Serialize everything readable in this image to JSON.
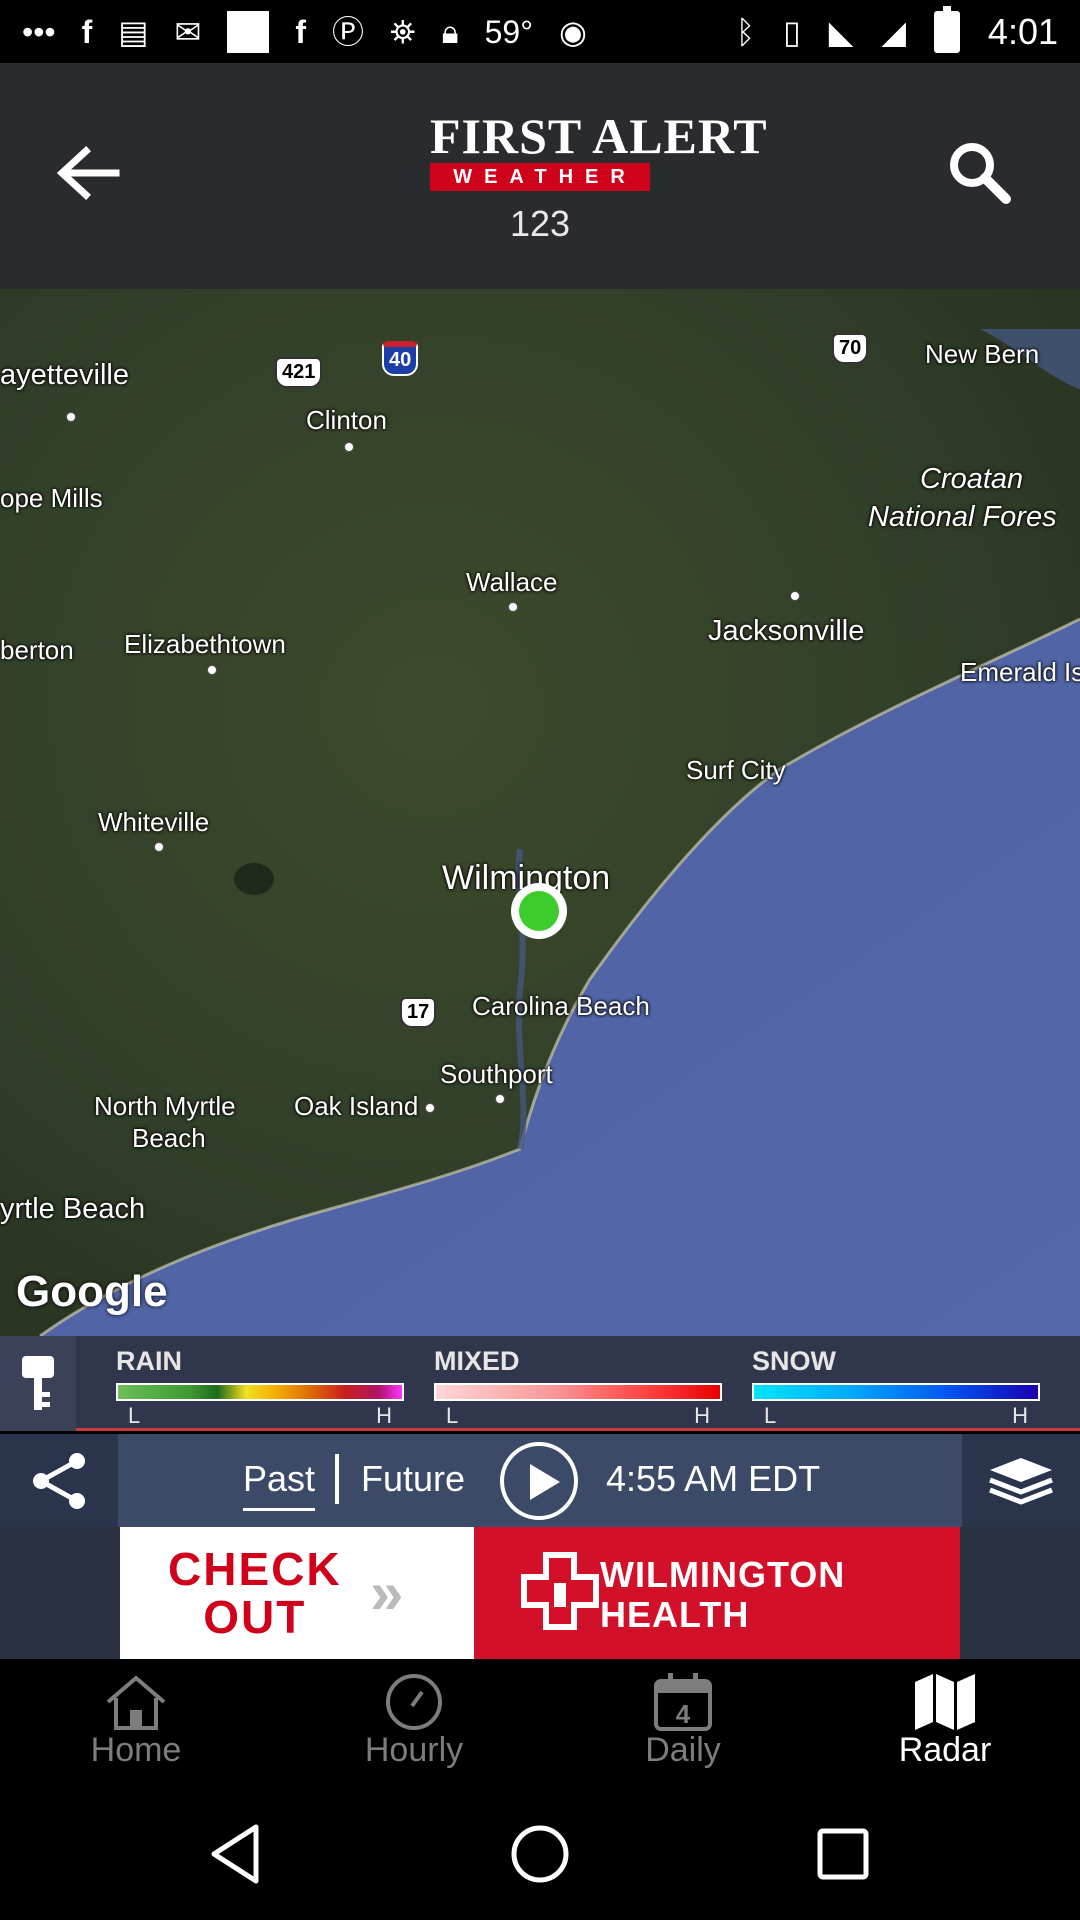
{
  "status_bar": {
    "temperature": "59°",
    "time": "4:01",
    "icons": [
      "more-icon",
      "facebook-icon",
      "news-icon",
      "mail-icon",
      "photo-icon",
      "facebook-icon",
      "p-icon",
      "satellite-icon",
      "lock-icon",
      "android-icon",
      "bluetooth-icon",
      "vibrate-icon",
      "wifi-icon",
      "signal-icon",
      "battery-icon"
    ]
  },
  "header": {
    "logo_main": "FIRST ALERT",
    "logo_sub": "WEATHER",
    "station": "123",
    "back_icon": "arrow-left-icon",
    "search_icon": "search-icon",
    "background": "#2a2b2e"
  },
  "map": {
    "cities": {
      "fayetteville": "ayetteville",
      "clinton": "Clinton",
      "new_bern": "New Bern",
      "hope_mills": "ope Mills",
      "croatan": "Croatan",
      "national_forest": "National Fores",
      "wallace": "Wallace",
      "jacksonville": "Jacksonville",
      "lumberton": "berton",
      "elizabethtown": "Elizabethtown",
      "emerald_isle": "Emerald Is",
      "surf_city": "Surf City",
      "whiteville": "Whiteville",
      "wilmington": "Wilmington",
      "carolina_beach": "Carolina Beach",
      "southport": "Southport",
      "north_myrtle_beach_1": "North Myrtle",
      "north_myrtle_beach_2": "Beach",
      "oak_island": "Oak Island",
      "myrtle_beach": "yrtle Beach"
    },
    "shields": {
      "us421": "421",
      "i40": "40",
      "us70": "70",
      "us17": "17"
    },
    "attribution": "Google",
    "location_color": "#3dcc2c"
  },
  "legend": {
    "rain": {
      "title": "RAIN",
      "low": "L",
      "high": "H"
    },
    "mixed": {
      "title": "MIXED",
      "low": "L",
      "high": "H"
    },
    "snow": {
      "title": "SNOW",
      "low": "L",
      "high": "H"
    },
    "key_icon": "key-icon"
  },
  "controls": {
    "past_label": "Past",
    "future_label": "Future",
    "timestamp": "4:55 AM EDT",
    "share_icon": "share-icon",
    "play_icon": "play-icon",
    "layers_icon": "layers-icon"
  },
  "ad": {
    "check_line1": "CHECK",
    "check_line2": "OUT",
    "brand_line1": "WILMINGTON",
    "brand_line2": "HEALTH",
    "brand_color": "#d2102a"
  },
  "bottom_nav": {
    "items": [
      {
        "label": "Home",
        "icon": "home-icon",
        "active": false
      },
      {
        "label": "Hourly",
        "icon": "clock-icon",
        "active": false
      },
      {
        "label": "Daily",
        "icon": "calendar-icon",
        "active": false,
        "badge": "4"
      },
      {
        "label": "Radar",
        "icon": "map-icon",
        "active": true
      }
    ]
  },
  "system_nav": {
    "back_icon": "triangle-back-icon",
    "home_icon": "circle-home-icon",
    "recents_icon": "square-recents-icon"
  }
}
